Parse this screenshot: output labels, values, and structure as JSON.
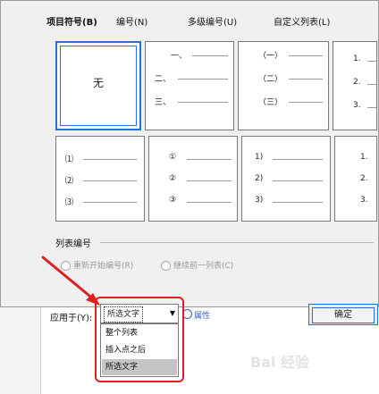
{
  "tabs": [
    {
      "label": "项目符号(B)",
      "active": true
    },
    {
      "label": "编号(N)",
      "active": false
    },
    {
      "label": "多级编号(U)",
      "active": false
    },
    {
      "label": "自定义列表(L)",
      "active": false
    }
  ],
  "gallery": {
    "none_label": "无",
    "row1": [
      {
        "levels": [
          "一、",
          "（一）",
          "1."
        ]
      },
      {
        "levels": [
          "二、",
          "（二）",
          "2."
        ]
      },
      {
        "levels": [
          "三、",
          "（三）",
          "3."
        ]
      }
    ],
    "row2": [
      {
        "levels": [
          "⑴",
          "⑵",
          "⑶"
        ]
      },
      {
        "levels": [
          "①",
          "②",
          "③"
        ]
      },
      {
        "levels": [
          "1)",
          "2)",
          "3)"
        ]
      },
      {
        "levels": [
          "1.",
          "2.",
          "3."
        ]
      }
    ]
  },
  "list_numbering": {
    "section_label": "列表编号",
    "option_restart": "重新开始编号(R)",
    "option_continue": "继续前一列表(C)"
  },
  "apply_to": {
    "label": "应用于(Y):",
    "selected": "所选文字",
    "options": [
      "整个列表",
      "插入点之后",
      "所选文字"
    ]
  },
  "properties_label": "属性",
  "ok_label": "确定",
  "watermark": "Bai 经验"
}
